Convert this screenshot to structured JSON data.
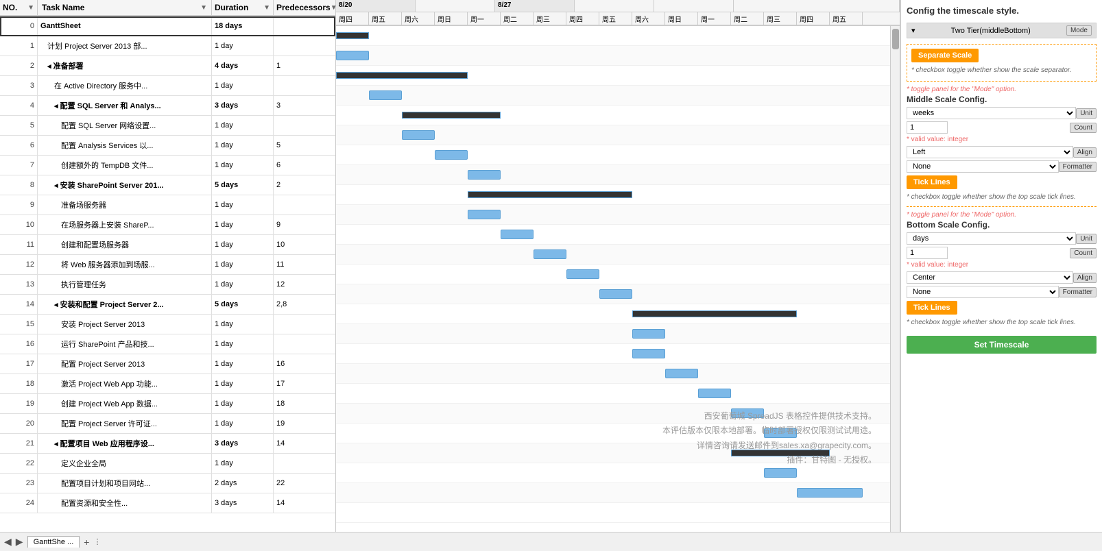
{
  "header": {
    "columns": {
      "no": "NO.",
      "taskName": "Task Name",
      "duration": "Duration",
      "predecessors": "Predecessors"
    }
  },
  "tasks": [
    {
      "no": "0",
      "name": "GanttSheet",
      "duration": "18 days",
      "pred": "",
      "level": 0,
      "bold": true,
      "collapse": true
    },
    {
      "no": "1",
      "name": "计划 Project Server 2013 部...",
      "duration": "1 day",
      "pred": "",
      "level": 1,
      "bold": false
    },
    {
      "no": "2",
      "name": "◂ 准备部署",
      "duration": "4 days",
      "pred": "1",
      "level": 1,
      "bold": true,
      "collapse": true
    },
    {
      "no": "3",
      "name": "在 Active Directory 服务中...",
      "duration": "1 day",
      "pred": "",
      "level": 2,
      "bold": false
    },
    {
      "no": "4",
      "name": "◂ 配置 SQL Server 和 Analys...",
      "duration": "3 days",
      "pred": "3",
      "level": 2,
      "bold": true,
      "collapse": true
    },
    {
      "no": "5",
      "name": "配置 SQL Server 网络设置...",
      "duration": "1 day",
      "pred": "",
      "level": 3,
      "bold": false
    },
    {
      "no": "6",
      "name": "配置 Analysis Services 以...",
      "duration": "1 day",
      "pred": "5",
      "level": 3,
      "bold": false
    },
    {
      "no": "7",
      "name": "创建额外的 TempDB 文件...",
      "duration": "1 day",
      "pred": "6",
      "level": 3,
      "bold": false
    },
    {
      "no": "8",
      "name": "◂ 安装 SharePoint Server 201...",
      "duration": "5 days",
      "pred": "2",
      "level": 2,
      "bold": true,
      "collapse": true
    },
    {
      "no": "9",
      "name": "准备场服务器",
      "duration": "1 day",
      "pred": "",
      "level": 3,
      "bold": false
    },
    {
      "no": "10",
      "name": "在场服务器上安装 ShareP...",
      "duration": "1 day",
      "pred": "9",
      "level": 3,
      "bold": false
    },
    {
      "no": "11",
      "name": "创建和配置场服务器",
      "duration": "1 day",
      "pred": "10",
      "level": 3,
      "bold": false
    },
    {
      "no": "12",
      "name": "将 Web 服务器添加到场服...",
      "duration": "1 day",
      "pred": "11",
      "level": 3,
      "bold": false
    },
    {
      "no": "13",
      "name": "执行管理任务",
      "duration": "1 day",
      "pred": "12",
      "level": 3,
      "bold": false
    },
    {
      "no": "14",
      "name": "◂ 安装和配置 Project Server 2...",
      "duration": "5 days",
      "pred": "2,8",
      "level": 2,
      "bold": true,
      "collapse": true
    },
    {
      "no": "15",
      "name": "安装 Project Server 2013",
      "duration": "1 day",
      "pred": "",
      "level": 3,
      "bold": false
    },
    {
      "no": "16",
      "name": "运行 SharePoint 产品和技...",
      "duration": "1 day",
      "pred": "",
      "level": 3,
      "bold": false
    },
    {
      "no": "17",
      "name": "配置 Project Server 2013",
      "duration": "1 day",
      "pred": "16",
      "level": 3,
      "bold": false
    },
    {
      "no": "18",
      "name": "激活 Project Web App 功能...",
      "duration": "1 day",
      "pred": "17",
      "level": 3,
      "bold": false
    },
    {
      "no": "19",
      "name": "创建 Project Web App 数据...",
      "duration": "1 day",
      "pred": "18",
      "level": 3,
      "bold": false
    },
    {
      "no": "20",
      "name": "配置 Project Server 许可证...",
      "duration": "1 day",
      "pred": "19",
      "level": 3,
      "bold": false
    },
    {
      "no": "21",
      "name": "◂ 配置项目 Web 应用程序设...",
      "duration": "3 days",
      "pred": "14",
      "level": 2,
      "bold": true,
      "collapse": true
    },
    {
      "no": "22",
      "name": "定义企业全局",
      "duration": "1 day",
      "pred": "",
      "level": 3,
      "bold": false
    },
    {
      "no": "23",
      "name": "配置项目计划和项目网站...",
      "duration": "2 days",
      "pred": "22",
      "level": 3,
      "bold": false
    },
    {
      "no": "24",
      "name": "配置资源和安全性...",
      "duration": "3 days",
      "pred": "14",
      "level": 3,
      "bold": false
    }
  ],
  "chart": {
    "dates_top": [
      "8/20",
      "",
      "8/27"
    ],
    "days": [
      "周四",
      "周五",
      "周六",
      "周日",
      "周一",
      "周二",
      "周三",
      "周四",
      "周五",
      "周六",
      "周日",
      "周一",
      "周二",
      "周三",
      "周四",
      "周五"
    ],
    "watermark": {
      "line1": "西安葡萄城 SpreadJS 表格控件提供技术支持。",
      "line2": "本评估版本仅限本地部署。临时部署授权仅限测试试用途。",
      "line3": "详情咨询请发送邮件到sales.xa@grapecity.com。",
      "line4": "插件：甘特图 - 无授权。"
    }
  },
  "rightPanel": {
    "title": "Config the timescale style.",
    "modeSectionLabel": "Two Tier(middleBottom)",
    "modeBadge": "Mode",
    "separateScaleBtn": "Separate Scale",
    "separateScaleNote": "* checkbox toggle whether show the scale separator.",
    "toggleNote1": "* toggle panel for the \"Mode\" option.",
    "middleScaleTitle": "Middle Scale Config.",
    "middleUnit": "weeks",
    "middleUnitBadge": "Unit",
    "middleCount": "1",
    "middleCountBadge": "Count",
    "middleCountNote": "* valid value: integer",
    "middleAlign": "Left",
    "middleAlignBadge": "Align",
    "middleFormatter": "None",
    "middleFormatterBadge": "Formatter",
    "tickLinesBtn1": "Tick Lines",
    "tickLinesNote1": "* checkbox toggle whether show the top scale tick lines.",
    "toggleNote2": "* toggle panel for the \"Mode\" option.",
    "bottomScaleTitle": "Bottom Scale Config.",
    "bottomUnit": "days",
    "bottomUnitBadge": "Unit",
    "bottomCount": "1",
    "bottomCountBadge": "Count",
    "bottomCountNote": "* valid value: integer",
    "bottomAlign": "Center",
    "bottomAlignBadge": "Align",
    "bottomFormatter": "None",
    "bottomFormatterBadge": "Formatter",
    "tickLinesBtn2": "Tick Lines",
    "tickLinesNote2": "* checkbox toggle whether show the top scale tick lines.",
    "setTimescaleBtn": "Set Timescale"
  },
  "bottomBar": {
    "tab1": "GanttShe ...",
    "addTabIcon": "+",
    "icons": [
      "◀",
      "▶"
    ]
  }
}
